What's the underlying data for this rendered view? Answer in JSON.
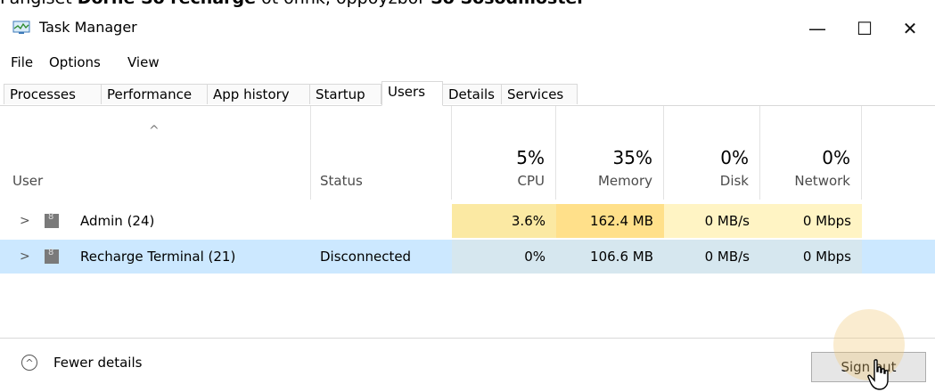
{
  "instruction": {
    "prefix": "Pangiset ",
    "bold1": "Dorhe So recharge",
    "mid": " ot onnk, oppoyzbor ",
    "bold2": "So Sosodmoster"
  },
  "window": {
    "title": "Task Manager",
    "minimize": "—",
    "maximize": "☐",
    "close": "✕"
  },
  "menu": [
    "File",
    "Options",
    "View"
  ],
  "tabs": [
    "Processes",
    "Performance",
    "App history",
    "Startup",
    "Users",
    "Details",
    "Services"
  ],
  "active_tab": "Users",
  "columns": {
    "user": {
      "label": "User"
    },
    "status": {
      "label": "Status"
    },
    "cpu": {
      "pct": "5%",
      "label": "CPU"
    },
    "memory": {
      "pct": "35%",
      "label": "Memory"
    },
    "disk": {
      "pct": "0%",
      "label": "Disk"
    },
    "network": {
      "pct": "0%",
      "label": "Network"
    }
  },
  "rows": [
    {
      "name": "Admin (24)",
      "status": "",
      "cpu": "3.6%",
      "memory": "162.4 MB",
      "disk": "0 MB/s",
      "network": "0 Mbps"
    },
    {
      "name": "Recharge Terminal (21)",
      "status": "Disconnected",
      "cpu": "0%",
      "memory": "106.6 MB",
      "disk": "0 MB/s",
      "network": "0 Mbps"
    }
  ],
  "footer": {
    "fewer_details": "Fewer details",
    "sign_out": "Sign out"
  },
  "colors": {
    "selected_row": "#cce8ff",
    "heat_light": "#fff4c4",
    "heat_medium": "#ffe8a6",
    "heat_cpu": "#fbe9a3"
  }
}
